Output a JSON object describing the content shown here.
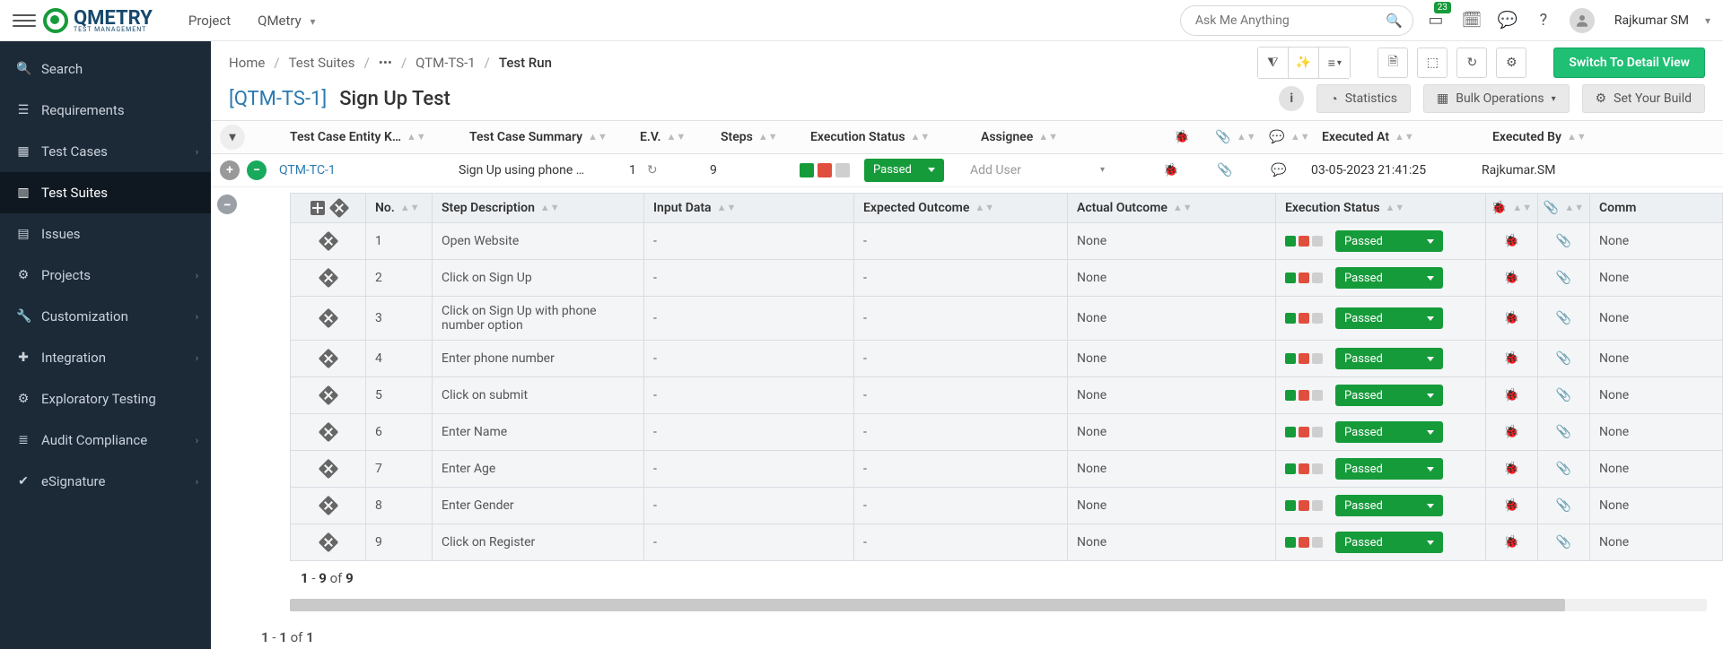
{
  "topbar": {
    "project_label": "Project",
    "project_name": "QMetry",
    "search_placeholder": "Ask Me Anything",
    "notif_count": "23",
    "user_name": "Rajkumar SM"
  },
  "logo": {
    "brand": "QMETRY",
    "sub": "TEST MANAGEMENT"
  },
  "sidebar": {
    "items": [
      {
        "label": "Search",
        "icon": "🔍",
        "chev": false
      },
      {
        "label": "Requirements",
        "icon": "☰",
        "chev": false
      },
      {
        "label": "Test Cases",
        "icon": "▦",
        "chev": true
      },
      {
        "label": "Test Suites",
        "icon": "▥",
        "chev": false,
        "active": true
      },
      {
        "label": "Issues",
        "icon": "▤",
        "chev": false
      },
      {
        "label": "Projects",
        "icon": "⚙",
        "chev": true
      },
      {
        "label": "Customization",
        "icon": "🔧",
        "chev": true
      },
      {
        "label": "Integration",
        "icon": "✚",
        "chev": true
      },
      {
        "label": "Exploratory Testing",
        "icon": "⚙",
        "chev": false
      },
      {
        "label": "Audit Compliance",
        "icon": "≣",
        "chev": true
      },
      {
        "label": "eSignature",
        "icon": "✔",
        "chev": true
      }
    ]
  },
  "breadcrumb": {
    "items": [
      "Home",
      "Test Suites",
      "•••",
      "QTM-TS-1",
      "Test Run"
    ]
  },
  "toolbar": {
    "switch_label": "Switch To Detail View"
  },
  "title": {
    "key": "[QTM-TS-1]",
    "name": "Sign Up Test",
    "stats": "Statistics",
    "bulk": "Bulk Operations",
    "build": "Set Your Build"
  },
  "outer_columns": {
    "entity": "Test Case Entity K…",
    "summary": "Test Case Summary",
    "ev": "E.V.",
    "steps": "Steps",
    "exec": "Execution Status",
    "assignee": "Assignee",
    "exec_at": "Executed At",
    "exec_by": "Executed By"
  },
  "outer_row": {
    "entity": "QTM-TC-1",
    "summary": "Sign Up using phone …",
    "ev": "1",
    "steps": "9",
    "status": "Passed",
    "assignee_placeholder": "Add User",
    "exec_at": "03-05-2023 21:41:25",
    "exec_by": "Rajkumar.SM"
  },
  "inner_columns": {
    "no": "No.",
    "step": "Step Description",
    "input": "Input Data",
    "expected": "Expected Outcome",
    "actual": "Actual Outcome",
    "exec": "Execution Status",
    "comm": "Comm"
  },
  "steps": [
    {
      "no": "1",
      "desc": "Open Website",
      "input": "-",
      "exp": "-",
      "act": "None",
      "status": "Passed",
      "comm": "None"
    },
    {
      "no": "2",
      "desc": "Click on Sign Up",
      "input": "-",
      "exp": "-",
      "act": "None",
      "status": "Passed",
      "comm": "None"
    },
    {
      "no": "3",
      "desc": "Click on Sign Up with phone number option",
      "input": "-",
      "exp": "-",
      "act": "None",
      "status": "Passed",
      "comm": "None"
    },
    {
      "no": "4",
      "desc": "Enter phone number",
      "input": "-",
      "exp": "-",
      "act": "None",
      "status": "Passed",
      "comm": "None"
    },
    {
      "no": "5",
      "desc": "Click on submit",
      "input": "-",
      "exp": "-",
      "act": "None",
      "status": "Passed",
      "comm": "None"
    },
    {
      "no": "6",
      "desc": "Enter Name",
      "input": "-",
      "exp": "-",
      "act": "None",
      "status": "Passed",
      "comm": "None"
    },
    {
      "no": "7",
      "desc": "Enter Age",
      "input": "-",
      "exp": "-",
      "act": "None",
      "status": "Passed",
      "comm": "None"
    },
    {
      "no": "8",
      "desc": "Enter Gender",
      "input": "-",
      "exp": "-",
      "act": "None",
      "status": "Passed",
      "comm": "None"
    },
    {
      "no": "9",
      "desc": "Click on Register",
      "input": "-",
      "exp": "-",
      "act": "None",
      "status": "Passed",
      "comm": "None"
    }
  ],
  "pager_inner": {
    "from": "1",
    "to": "9",
    "of_label": "of",
    "total": "9",
    "dash": "-"
  },
  "pager_outer": {
    "from": "1",
    "to": "1",
    "of_label": "of",
    "total": "1",
    "dash": "-"
  }
}
